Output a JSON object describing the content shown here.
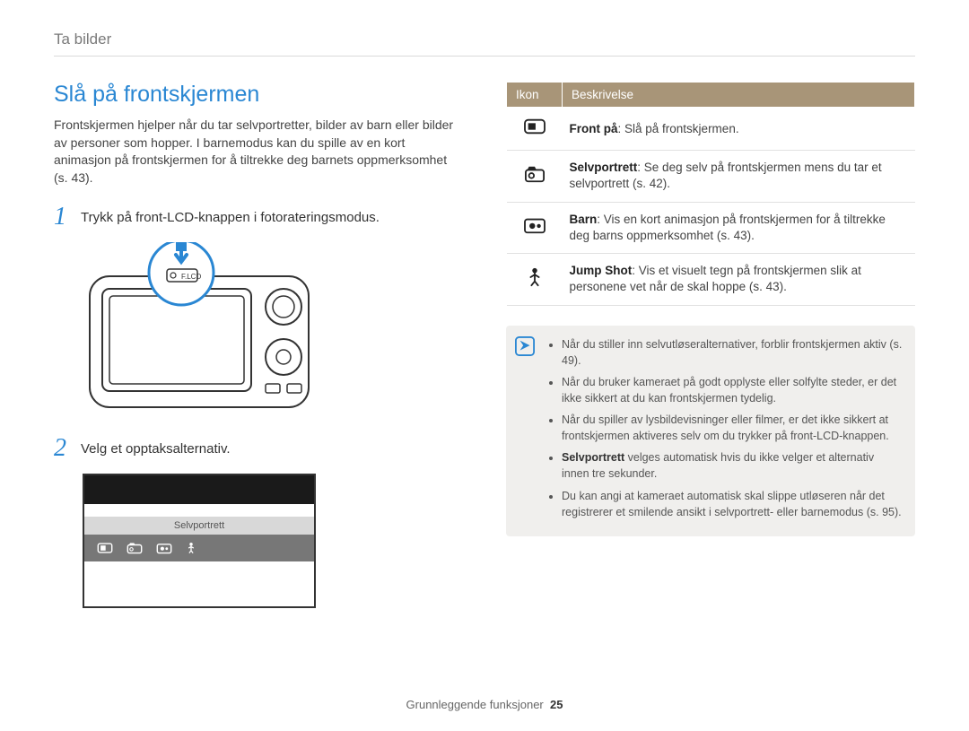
{
  "breadcrumb": "Ta bilder",
  "section_title": "Slå på frontskjermen",
  "intro": "Frontskjermen hjelper når du tar selvportretter, bilder av barn eller bilder av personer som hopper. I barnemodus kan du spille av en kort animasjon på frontskjermen for å tiltrekke deg barnets oppmerksomhet (s. 43).",
  "steps": {
    "1": {
      "num": "1",
      "text": "Trykk på front-LCD-knappen i fotorateringsmodus."
    },
    "2": {
      "num": "2",
      "text": "Velg et opptaksalternativ."
    }
  },
  "camera_label": "F.LCD",
  "opts_label": "Selvportrett",
  "table": {
    "head_icon": "Ikon",
    "head_desc": "Beskrivelse",
    "rows": {
      "front": {
        "bold": "Front på",
        "sep": ": ",
        "text": "Slå på frontskjermen."
      },
      "selfie": {
        "bold": "Selvportrett",
        "sep": ": ",
        "text": "Se deg selv på frontskjermen mens du tar et selvportrett (s. 42)."
      },
      "children": {
        "bold": "Barn",
        "sep": ": ",
        "text": "Vis en kort animasjon på frontskjermen for å tiltrekke deg barns oppmerksomhet (s. 43)."
      },
      "jump": {
        "bold": "Jump Shot",
        "sep": ": ",
        "text": "Vis et visuelt tegn på frontskjermen slik at personene vet når de skal hoppe (s. 43)."
      }
    }
  },
  "notes": {
    "0": "Når du stiller inn selvutløseralternativer, forblir frontskjermen aktiv (s. 49).",
    "1": "Når du bruker kameraet på godt opplyste eller solfylte steder, er det ikke sikkert at du kan frontskjermen tydelig.",
    "2": "Når du spiller av lysbildevisninger eller filmer, er det ikke sikkert at frontskjermen aktiveres selv om du trykker på front-LCD-knappen.",
    "3_bold": "Selvportrett",
    "3_rest": " velges automatisk hvis du ikke velger et alternativ innen tre sekunder.",
    "4": "Du kan angi at kameraet automatisk skal slippe utløseren når det registrerer et smilende ansikt i selvportrett- eller barnemodus (s. 95)."
  },
  "footer_label": "Grunnleggende funksjoner",
  "footer_page": "25"
}
